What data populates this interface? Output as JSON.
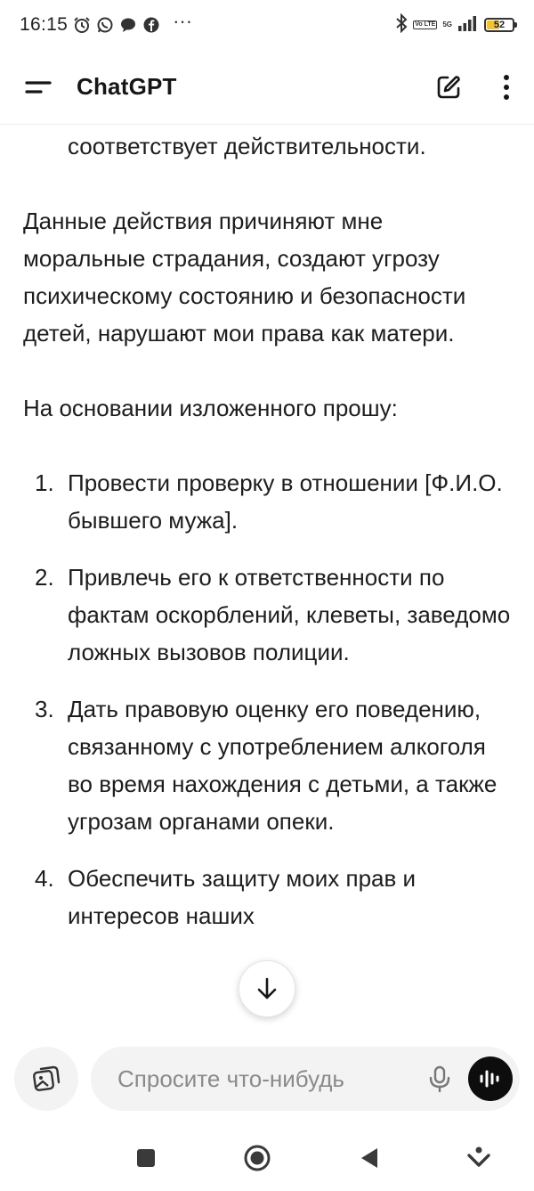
{
  "status_bar": {
    "time": "16:15",
    "battery_level": "52",
    "network_gen": "5G",
    "volte_label": "Vo LTE",
    "more_glyph": "···",
    "icons": [
      "alarm-icon",
      "whatsapp-icon",
      "chat-bubble-icon",
      "facebook-icon",
      "bluetooth-icon",
      "signal-icon",
      "battery-icon"
    ],
    "battery_color": "#f2c230"
  },
  "header": {
    "title": "ChatGPT",
    "icons": [
      "menu-icon",
      "new-chat-icon",
      "more-vertical-icon"
    ]
  },
  "message": {
    "carry_line": "соответствует действительности.",
    "paragraph_1": "Данные действия причиняют мне моральные страдания, создают угрозу психическому состоянию и безопасности детей, нарушают мои права как матери.",
    "paragraph_2": "На основании изложенного прошу:",
    "requests": [
      {
        "number": "1.",
        "text": "Провести проверку в отношении [Ф.И.О. бывшего мужа]."
      },
      {
        "number": "2.",
        "text": "Привлечь его к ответственности по фактам оскорблений, клеветы, заведомо ложных вызовов полиции."
      },
      {
        "number": "3.",
        "text": "Дать правовую оценку его поведению, связанному с употреблением алкоголя во время нахождения с детьми, а также угрозам органами опеки."
      },
      {
        "number": "4.",
        "text": "Обеспечить защиту моих прав и интересов наших"
      }
    ]
  },
  "composer": {
    "placeholder": "Спросите что-нибудь",
    "value": ""
  },
  "colors": {
    "text": "#1d1d1d",
    "placeholder": "#8a8a8a",
    "input_bg": "#f3f3f3",
    "voice_button_bg": "#0d0d0d"
  }
}
